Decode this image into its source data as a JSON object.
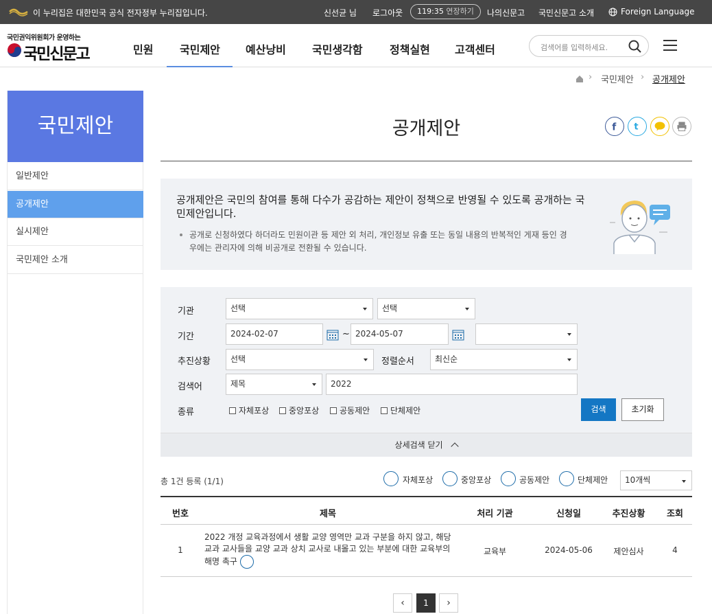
{
  "gov": {
    "notice": "이 누리집은 대한민국 공식 전자정부 누리집입니다.",
    "user": "신선균 님",
    "logout": "로그아웃",
    "timer": "119:35",
    "extend": "연장하기",
    "my": "나의신문고",
    "about": "국민신문고 소개",
    "lang": "Foreign Language"
  },
  "header": {
    "logo_sub": "국민권익위원회가 운영하는",
    "logo_name": "국민신문고",
    "nav": [
      "민원",
      "국민제안",
      "예산낭비",
      "국민생각함",
      "정책실현",
      "고객센터"
    ],
    "search_placeholder": "검색어를 입력하세요."
  },
  "breadcrumb": {
    "items": [
      "국민제안",
      "공개제안"
    ]
  },
  "sidebar": {
    "title": "국민제안",
    "items": [
      "일반제안",
      "공개제안",
      "실시제안",
      "국민제안 소개"
    ]
  },
  "main": {
    "title": "공개제안"
  },
  "info": {
    "line1": "공개제안은 국민의 참여를 통해 다수가 공감하는 제안이 정책으로 반영될 수 있도록 공개하는 국민제안입니다.",
    "line2": "공개로 신청하였다 하더라도 민원이관 등 제안 외 처리, 개인정보 유출 또는 동일 내용의 반복적인 게재 등인 경우에는 관리자에 의해 비공개로 전환될 수 있습니다."
  },
  "filter": {
    "org_label": "기관",
    "org1": "선택",
    "org2": "선택",
    "period_label": "기간",
    "date_from": "2024-02-07",
    "tilde": "~",
    "date_to": "2024-05-07",
    "period_select": "",
    "status_label": "추진상황",
    "status": "선택",
    "sort_label": "정렬순서",
    "sort": "최신순",
    "keyword_label": "검색어",
    "keyword_type": "제목",
    "keyword": "2022",
    "type_label": "종류",
    "types": [
      "자체포상",
      "중앙포상",
      "공동제안",
      "단체제안"
    ],
    "search_btn": "검색",
    "reset_btn": "초기화",
    "fold": "상세검색 닫기"
  },
  "list": {
    "count": "총 1건 등록 (1/1)",
    "legend": [
      "자체포상",
      "중앙포상",
      "공동제안",
      "단체제안"
    ],
    "per_page": "10개씩",
    "headers": [
      "번호",
      "제목",
      "처리 기관",
      "신청일",
      "추진상황",
      "조회"
    ],
    "rows": [
      {
        "no": "1",
        "title": "2022 개정 교육과정에서 생활 교양 영역만 교과 구분을 하지 않고, 해당 교과 교사들을 교양 교과 상치 교사로 내몰고 있는 부분에 대한 교육부의 해명 촉구",
        "org": "교육부",
        "date": "2024-05-06",
        "status": "제안심사",
        "views": "4"
      }
    ]
  },
  "pagination": {
    "current": "1"
  }
}
